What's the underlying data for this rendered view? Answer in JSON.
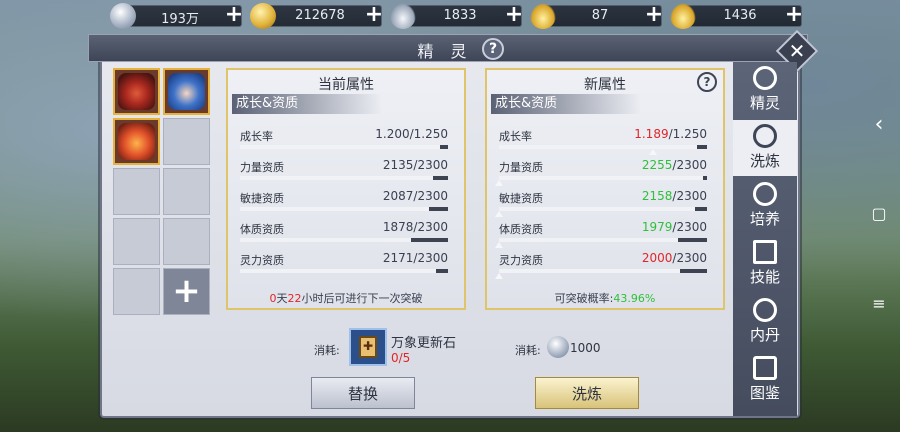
{
  "currencies": [
    {
      "icon": "silver-coin-icon",
      "value": "193万"
    },
    {
      "icon": "gold-coin-icon",
      "value": "212678"
    },
    {
      "icon": "silver-ingot-icon",
      "value": "1833"
    },
    {
      "icon": "gold-ingot-icon",
      "value": "87"
    },
    {
      "icon": "gold-ingot-stack-icon",
      "value": "1436"
    }
  ],
  "header": {
    "title": "精 灵",
    "help": "?",
    "close": "✕"
  },
  "pet_grid": {
    "add_symbol": "+"
  },
  "current_card": {
    "title": "当前属性",
    "section": "成长&资质",
    "rows": [
      {
        "label": "成长率",
        "value": "1.200/1.250",
        "fill": 0.96
      },
      {
        "label": "力量资质",
        "value": "2135/2300",
        "fill": 0.93
      },
      {
        "label": "敏捷资质",
        "value": "2087/2300",
        "fill": 0.91
      },
      {
        "label": "体质资质",
        "value": "1878/2300",
        "fill": 0.82
      },
      {
        "label": "灵力资质",
        "value": "2171/2300",
        "fill": 0.94
      }
    ],
    "note": {
      "days": "0",
      "t1": "天",
      "hours": "22",
      "t2": "小时后可进行下一次突破"
    }
  },
  "new_card": {
    "title": "新属性",
    "help": "?",
    "section": "成长&资质",
    "rows": [
      {
        "label": "成长率",
        "value_new": "1.189",
        "value_max": "/1.250",
        "color": "red",
        "fill": 0.95
      },
      {
        "label": "力量资质",
        "value_new": "2255",
        "value_max": "/2300",
        "color": "green",
        "fill": 0.98
      },
      {
        "label": "敏捷资质",
        "value_new": "2158",
        "value_max": "/2300",
        "color": "green",
        "fill": 0.94
      },
      {
        "label": "体质资质",
        "value_new": "1979",
        "value_max": "/2300",
        "color": "green",
        "fill": 0.86
      },
      {
        "label": "灵力资质",
        "value_new": "2000",
        "value_max": "/2300",
        "color": "red",
        "fill": 0.87
      }
    ],
    "note_label": "可突破概率:",
    "note_value": "43.96%"
  },
  "cost": {
    "label1": "消耗:",
    "item_name": "万象更新石",
    "item_count": "0/5",
    "label2": "消耗:",
    "silver": "1000"
  },
  "buttons": {
    "swap": "替换",
    "refine": "洗炼"
  },
  "tabs": [
    {
      "label": "精灵",
      "icon": "spirit-icon",
      "active": false
    },
    {
      "label": "洗炼",
      "icon": "refine-icon",
      "active": true
    },
    {
      "label": "培养",
      "icon": "train-icon",
      "active": false
    },
    {
      "label": "技能",
      "icon": "skill-icon",
      "active": false
    },
    {
      "label": "内丹",
      "icon": "inner-core-icon",
      "active": false
    },
    {
      "label": "图鉴",
      "icon": "handbook-icon",
      "active": false
    }
  ],
  "android_nav": {
    "back": "‹",
    "home": "▢",
    "menu": "≡"
  },
  "colors": {
    "red": "#e0262a",
    "green": "#2fbf3a",
    "gold_border": "#e0c46a"
  }
}
